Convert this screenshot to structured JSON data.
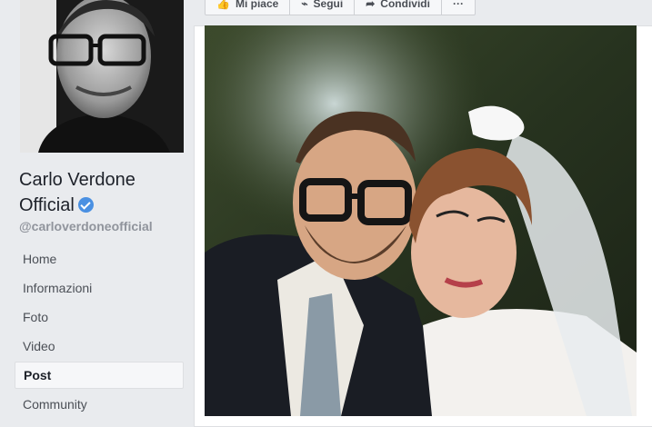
{
  "page": {
    "name_line1": "Carlo Verdone",
    "name_line2": "Official",
    "handle": "@carloverdoneofficial"
  },
  "nav": {
    "items": [
      {
        "label": "Home",
        "active": false
      },
      {
        "label": "Informazioni",
        "active": false
      },
      {
        "label": "Foto",
        "active": false
      },
      {
        "label": "Video",
        "active": false
      },
      {
        "label": "Post",
        "active": true
      },
      {
        "label": "Community",
        "active": false
      }
    ]
  },
  "actions": {
    "like": "Mi piace",
    "follow": "Segui",
    "share": "Condividi",
    "more": "···"
  },
  "colors": {
    "background": "#e9ebee",
    "verified": "#4a90e2",
    "text": "#1d2129",
    "muted": "#90949c"
  }
}
